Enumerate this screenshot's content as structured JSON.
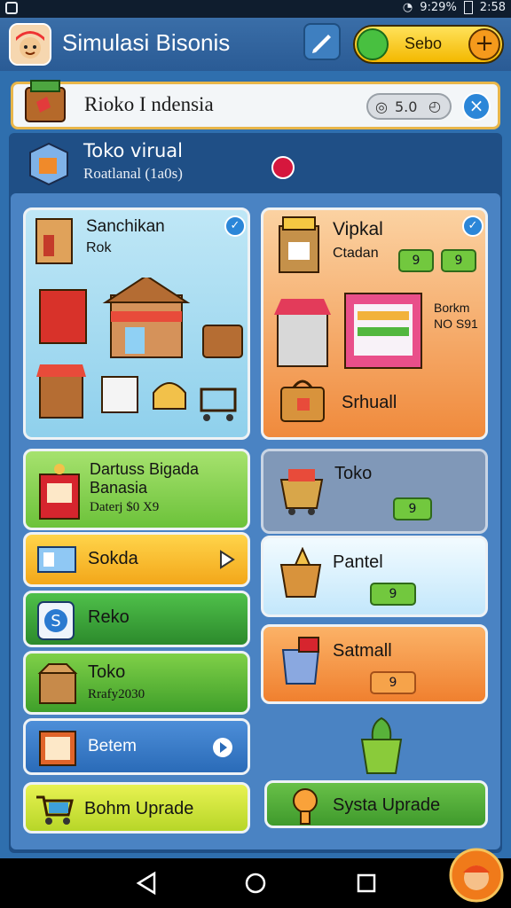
{
  "status_bar": {
    "signal_text": "9:29%",
    "time": "2:58"
  },
  "app_bar": {
    "title": "Simulasi Bisonis",
    "coin_label": "Sebo",
    "plus_label": "+"
  },
  "store_header": {
    "name": "Rioko I ndensia",
    "rating": "5.0",
    "close_label": "×"
  },
  "virtual_store": {
    "title": "Toko virual",
    "subtitle": "Roatlanal (1a0s)"
  },
  "cards": {
    "sanchikan": {
      "title": "Sanchikan",
      "subtitle": "Rok"
    },
    "vipkal": {
      "title": "Vipkal",
      "subtitle": "Ctadan",
      "badge_1": "9",
      "badge_2": "9",
      "side_text_1": "Borkm",
      "side_text_2": "NO S91",
      "bottom_label": "Srhuall"
    },
    "dartuss": {
      "title_line1": "Dartuss Bigada",
      "title_line2": "Banasia",
      "subtitle": "Daterj $0 X9"
    },
    "sokda": {
      "title": "Sokda"
    },
    "toko_right": {
      "title": "Toko",
      "badge": "9"
    },
    "reko": {
      "title": "Reko"
    },
    "pantel": {
      "title": "Pantel",
      "badge": "9"
    },
    "toko_left": {
      "title": "Toko",
      "subtitle": "Rrafy2030"
    },
    "satmall": {
      "title": "Satmall",
      "badge": "9"
    },
    "betem": {
      "title": "Betem"
    },
    "bohm_upgrade": {
      "title": "Bohm Uprade"
    },
    "systa_upgrade": {
      "title": "Systa Uprade"
    }
  }
}
